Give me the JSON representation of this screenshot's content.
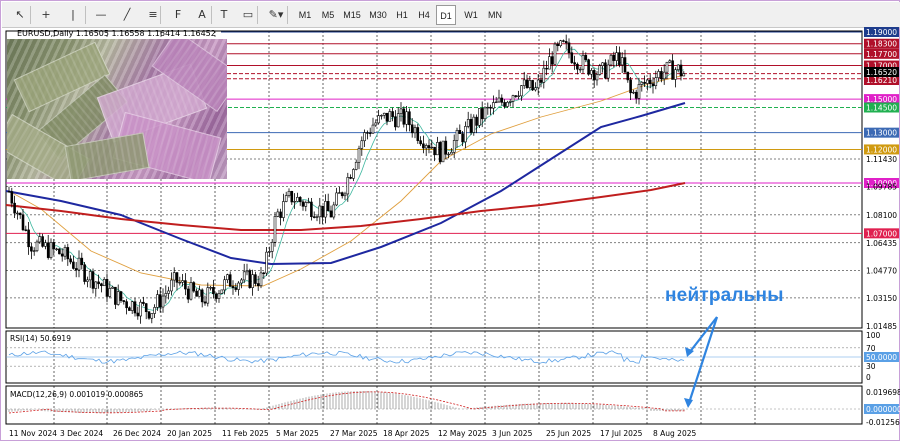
{
  "toolbar": {
    "tools": [
      {
        "name": "cursor-icon",
        "glyph": "↖"
      },
      {
        "name": "crosshair-icon",
        "glyph": "+"
      },
      {
        "name": "vertical-line-icon",
        "glyph": "|"
      },
      {
        "name": "horizontal-line-icon",
        "glyph": "—"
      },
      {
        "name": "trendline-icon",
        "glyph": "╱"
      },
      {
        "name": "channel-icon",
        "glyph": "≡"
      },
      {
        "name": "fibonacci-icon",
        "glyph": "F"
      },
      {
        "name": "text-icon",
        "glyph": "A"
      },
      {
        "name": "text-label-icon",
        "glyph": "T"
      },
      {
        "name": "rectangle-icon",
        "glyph": "▭"
      },
      {
        "name": "shapes-dropdown-icon",
        "glyph": "✎▾"
      }
    ],
    "timeframes": [
      "M1",
      "M5",
      "M15",
      "M30",
      "H1",
      "H4",
      "D1",
      "W1",
      "MN"
    ],
    "active_timeframe": "D1"
  },
  "chart": {
    "header": "EURUSD,Daily  1.16505 1.16558 1.16414 1.16452",
    "price_labels": [
      {
        "text": "1.19000",
        "kind": "box",
        "color": "#1e3c8c"
      },
      {
        "text": "1.18300",
        "kind": "box",
        "color": "#b0102a"
      },
      {
        "text": "1.17700",
        "kind": "box",
        "color": "#b0102a"
      },
      {
        "text": "1.17000",
        "kind": "box",
        "color": "#b0102a"
      },
      {
        "text": "1.16520",
        "kind": "box",
        "color": "#b0102a"
      },
      {
        "text": "1.16210",
        "kind": "box",
        "color": "#b0102a"
      },
      {
        "text": "1.15000",
        "kind": "box",
        "color": "#e020c8"
      },
      {
        "text": "1.14500",
        "kind": "box",
        "color": "#20b050"
      },
      {
        "text": "1.13000",
        "kind": "box",
        "color": "#3c6ab4"
      },
      {
        "text": "1.12000",
        "kind": "box",
        "color": "#d09a10"
      },
      {
        "text": "1.11430",
        "kind": "plain"
      },
      {
        "text": "1.10000",
        "kind": "box",
        "color": "#e020c8"
      },
      {
        "text": "1.09785",
        "kind": "plain"
      },
      {
        "text": "1.08100",
        "kind": "plain"
      },
      {
        "text": "1.07000",
        "kind": "box",
        "color": "#e02050"
      },
      {
        "text": "1.06435",
        "kind": "plain"
      },
      {
        "text": "1.04770",
        "kind": "plain"
      },
      {
        "text": "1.03150",
        "kind": "plain"
      },
      {
        "text": "1.01485",
        "kind": "plain"
      }
    ],
    "dates": [
      "11 Nov 2024",
      "3 Dec 2024",
      "26 Dec 2024",
      "20 Jan 2025",
      "11 Feb 2025",
      "5 Mar 2025",
      "27 Mar 2025",
      "18 Apr 2025",
      "12 May 2025",
      "3 Jun 2025",
      "25 Jun 2025",
      "17 Jul 2025",
      "8 Aug 2025"
    ]
  },
  "rsi": {
    "label": "RSI(14) 50.6919",
    "levels": [
      "100",
      "70",
      "50.0000",
      "30",
      "0"
    ]
  },
  "macd": {
    "label": "MACD(12,26,9) 0.001019 0.000865",
    "levels": [
      "0.019698",
      "0.000000",
      "-0.012561"
    ]
  },
  "annotation": "нейтральны",
  "colors": {
    "candle": "#000000",
    "ma_fast": "#40b8a0",
    "ma_mid": "#e0a040",
    "ma_slow_blue": "#1e28a0",
    "ma_slow_red": "#c01e1e",
    "annotation": "#2f84e0",
    "rsi_line": "#5aa0e6",
    "macd_signal": "#d02020"
  }
}
